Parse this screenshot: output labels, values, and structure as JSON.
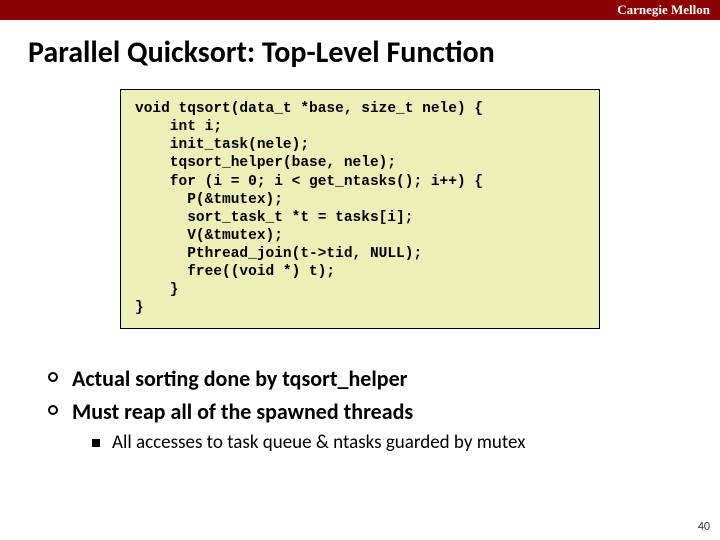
{
  "brand": "Carnegie Mellon",
  "title": "Parallel Quicksort: Top-Level Function",
  "code": "void tqsort(data_t *base, size_t nele) {\n    int i;\n    init_task(nele);\n    tqsort_helper(base, nele);\n    for (i = 0; i < get_ntasks(); i++) {\n      P(&tmutex);\n      sort_task_t *t = tasks[i];\n      V(&tmutex);\n      Pthread_join(t->tid, NULL);\n      free((void *) t);\n    }\n}",
  "bullets": {
    "b1": "Actual sorting done by tqsort_helper",
    "b2": "Must reap all of the spawned threads",
    "b2_sub": "All accesses to task queue & ntasks guarded by mutex"
  },
  "page": "40"
}
